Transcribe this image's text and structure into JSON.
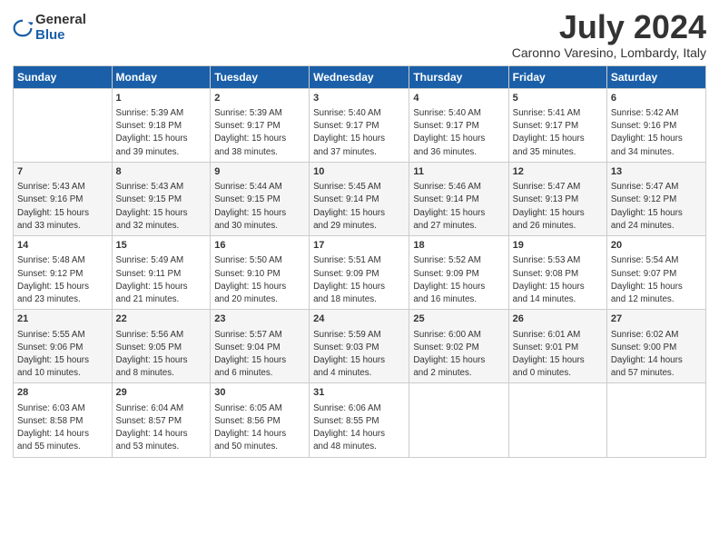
{
  "logo": {
    "general": "General",
    "blue": "Blue"
  },
  "title": "July 2024",
  "location": "Caronno Varesino, Lombardy, Italy",
  "days_of_week": [
    "Sunday",
    "Monday",
    "Tuesday",
    "Wednesday",
    "Thursday",
    "Friday",
    "Saturday"
  ],
  "weeks": [
    [
      {
        "day": "",
        "content": ""
      },
      {
        "day": "1",
        "content": "Sunrise: 5:39 AM\nSunset: 9:18 PM\nDaylight: 15 hours\nand 39 minutes."
      },
      {
        "day": "2",
        "content": "Sunrise: 5:39 AM\nSunset: 9:17 PM\nDaylight: 15 hours\nand 38 minutes."
      },
      {
        "day": "3",
        "content": "Sunrise: 5:40 AM\nSunset: 9:17 PM\nDaylight: 15 hours\nand 37 minutes."
      },
      {
        "day": "4",
        "content": "Sunrise: 5:40 AM\nSunset: 9:17 PM\nDaylight: 15 hours\nand 36 minutes."
      },
      {
        "day": "5",
        "content": "Sunrise: 5:41 AM\nSunset: 9:17 PM\nDaylight: 15 hours\nand 35 minutes."
      },
      {
        "day": "6",
        "content": "Sunrise: 5:42 AM\nSunset: 9:16 PM\nDaylight: 15 hours\nand 34 minutes."
      }
    ],
    [
      {
        "day": "7",
        "content": "Sunrise: 5:43 AM\nSunset: 9:16 PM\nDaylight: 15 hours\nand 33 minutes."
      },
      {
        "day": "8",
        "content": "Sunrise: 5:43 AM\nSunset: 9:15 PM\nDaylight: 15 hours\nand 32 minutes."
      },
      {
        "day": "9",
        "content": "Sunrise: 5:44 AM\nSunset: 9:15 PM\nDaylight: 15 hours\nand 30 minutes."
      },
      {
        "day": "10",
        "content": "Sunrise: 5:45 AM\nSunset: 9:14 PM\nDaylight: 15 hours\nand 29 minutes."
      },
      {
        "day": "11",
        "content": "Sunrise: 5:46 AM\nSunset: 9:14 PM\nDaylight: 15 hours\nand 27 minutes."
      },
      {
        "day": "12",
        "content": "Sunrise: 5:47 AM\nSunset: 9:13 PM\nDaylight: 15 hours\nand 26 minutes."
      },
      {
        "day": "13",
        "content": "Sunrise: 5:47 AM\nSunset: 9:12 PM\nDaylight: 15 hours\nand 24 minutes."
      }
    ],
    [
      {
        "day": "14",
        "content": "Sunrise: 5:48 AM\nSunset: 9:12 PM\nDaylight: 15 hours\nand 23 minutes."
      },
      {
        "day": "15",
        "content": "Sunrise: 5:49 AM\nSunset: 9:11 PM\nDaylight: 15 hours\nand 21 minutes."
      },
      {
        "day": "16",
        "content": "Sunrise: 5:50 AM\nSunset: 9:10 PM\nDaylight: 15 hours\nand 20 minutes."
      },
      {
        "day": "17",
        "content": "Sunrise: 5:51 AM\nSunset: 9:09 PM\nDaylight: 15 hours\nand 18 minutes."
      },
      {
        "day": "18",
        "content": "Sunrise: 5:52 AM\nSunset: 9:09 PM\nDaylight: 15 hours\nand 16 minutes."
      },
      {
        "day": "19",
        "content": "Sunrise: 5:53 AM\nSunset: 9:08 PM\nDaylight: 15 hours\nand 14 minutes."
      },
      {
        "day": "20",
        "content": "Sunrise: 5:54 AM\nSunset: 9:07 PM\nDaylight: 15 hours\nand 12 minutes."
      }
    ],
    [
      {
        "day": "21",
        "content": "Sunrise: 5:55 AM\nSunset: 9:06 PM\nDaylight: 15 hours\nand 10 minutes."
      },
      {
        "day": "22",
        "content": "Sunrise: 5:56 AM\nSunset: 9:05 PM\nDaylight: 15 hours\nand 8 minutes."
      },
      {
        "day": "23",
        "content": "Sunrise: 5:57 AM\nSunset: 9:04 PM\nDaylight: 15 hours\nand 6 minutes."
      },
      {
        "day": "24",
        "content": "Sunrise: 5:59 AM\nSunset: 9:03 PM\nDaylight: 15 hours\nand 4 minutes."
      },
      {
        "day": "25",
        "content": "Sunrise: 6:00 AM\nSunset: 9:02 PM\nDaylight: 15 hours\nand 2 minutes."
      },
      {
        "day": "26",
        "content": "Sunrise: 6:01 AM\nSunset: 9:01 PM\nDaylight: 15 hours\nand 0 minutes."
      },
      {
        "day": "27",
        "content": "Sunrise: 6:02 AM\nSunset: 9:00 PM\nDaylight: 14 hours\nand 57 minutes."
      }
    ],
    [
      {
        "day": "28",
        "content": "Sunrise: 6:03 AM\nSunset: 8:58 PM\nDaylight: 14 hours\nand 55 minutes."
      },
      {
        "day": "29",
        "content": "Sunrise: 6:04 AM\nSunset: 8:57 PM\nDaylight: 14 hours\nand 53 minutes."
      },
      {
        "day": "30",
        "content": "Sunrise: 6:05 AM\nSunset: 8:56 PM\nDaylight: 14 hours\nand 50 minutes."
      },
      {
        "day": "31",
        "content": "Sunrise: 6:06 AM\nSunset: 8:55 PM\nDaylight: 14 hours\nand 48 minutes."
      },
      {
        "day": "",
        "content": ""
      },
      {
        "day": "",
        "content": ""
      },
      {
        "day": "",
        "content": ""
      }
    ]
  ]
}
